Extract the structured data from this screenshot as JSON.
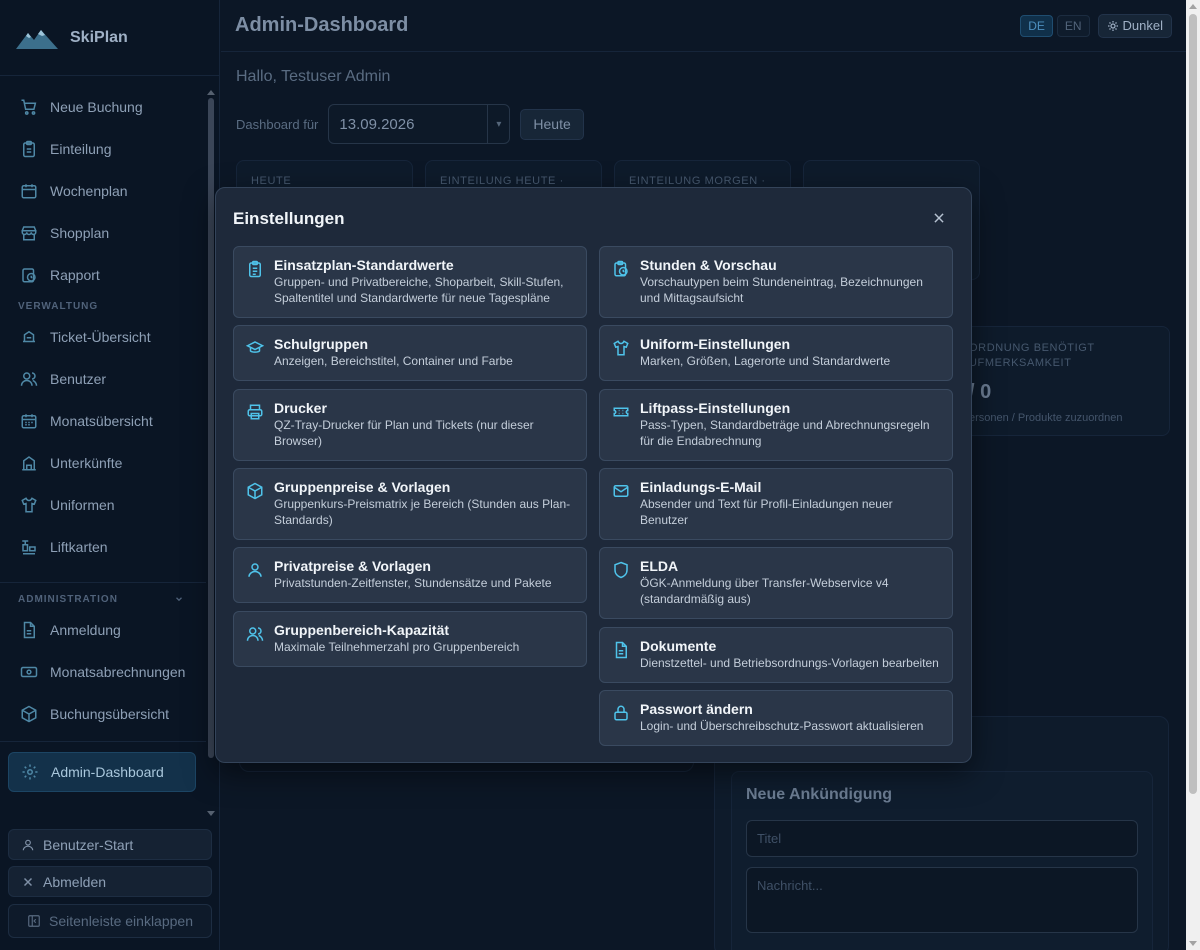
{
  "app": {
    "name": "SkiPlan"
  },
  "sidebar": {
    "items": [
      {
        "label": "Neue Buchung",
        "icon": "cart-icon"
      },
      {
        "label": "Einteilung",
        "icon": "clipboard-icon"
      },
      {
        "label": "Wochenplan",
        "icon": "calendar-icon"
      },
      {
        "label": "Shopplan",
        "icon": "store-icon"
      },
      {
        "label": "Rapport",
        "icon": "clock-report-icon"
      }
    ],
    "section_admin_title": "VERWALTUNG",
    "admin_items": [
      {
        "label": "Ticket-Übersicht",
        "icon": "ticket-icon"
      },
      {
        "label": "Benutzer",
        "icon": "users-icon"
      },
      {
        "label": "Monatsübersicht",
        "icon": "calendar-icon"
      },
      {
        "label": "Unterkünfte",
        "icon": "building-icon"
      },
      {
        "label": "Uniformen",
        "icon": "shirt-icon"
      },
      {
        "label": "Liftkarten",
        "icon": "lift-icon"
      }
    ],
    "section_administration_title": "ADMINISTRATION",
    "administration_items": [
      {
        "label": "Anmeldung",
        "icon": "document-icon"
      },
      {
        "label": "Monatsabrechnungen",
        "icon": "money-icon"
      },
      {
        "label": "Buchungsübersicht",
        "icon": "box-icon"
      }
    ],
    "active_item": {
      "label": "Admin-Dashboard",
      "icon": "gear-icon"
    },
    "user_start_label": "Benutzer-Start",
    "logout_label": "Abmelden",
    "collapse_label": "Seitenleiste einklappen"
  },
  "header": {
    "title": "Admin-Dashboard",
    "lang_de": "DE",
    "lang_en": "EN",
    "theme_label": "Dunkel"
  },
  "dashboard": {
    "greeting": "Hallo, Testuser Admin",
    "date_label": "Dashboard für",
    "date_value": "13.09.2026",
    "today_label": "Heute",
    "stats": [
      "HEUTE",
      "EINTEILUNG HEUTE ·",
      "EINTEILUNG MORGEN ·",
      ""
    ],
    "attention_card": {
      "title": "ORDNUNG BENÖTIGT UFMERKSAMKEIT",
      "value": "/ 0",
      "subtitle": "ersonen / Produkte zuzuordnen"
    },
    "announcement": {
      "title": "Neue Ankündigung",
      "title_placeholder": "Titel",
      "message_placeholder": "Nachricht..."
    }
  },
  "modal": {
    "title": "Einstellungen",
    "left": [
      {
        "title": "Einsatzplan-Standardwerte",
        "desc": "Gruppen- und Privatbereiche, Shoparbeit, Skill-Stufen, Spaltentitel und Standardwerte für neue Tagespläne",
        "icon": "clipboard-icon"
      },
      {
        "title": "Schulgruppen",
        "desc": "Anzeigen, Bereichstitel, Container und Farbe",
        "icon": "graduation-cap-icon"
      },
      {
        "title": "Drucker",
        "desc": "QZ-Tray-Drucker für Plan und Tickets (nur dieser Browser)",
        "icon": "printer-icon"
      },
      {
        "title": "Gruppenpreise & Vorlagen",
        "desc": "Gruppenkurs-Preismatrix je Bereich (Stunden aus Plan-Standards)",
        "icon": "cube-icon"
      },
      {
        "title": "Privatpreise & Vorlagen",
        "desc": "Privatstunden-Zeitfenster, Stundensätze und Pakete",
        "icon": "user-icon"
      },
      {
        "title": "Gruppenbereich-Kapazität",
        "desc": "Maximale Teilnehmerzahl pro Gruppenbereich",
        "icon": "users-icon"
      }
    ],
    "right": [
      {
        "title": "Stunden & Vorschau",
        "desc": "Vorschautypen beim Stundeneintrag, Bezeichnungen und Mittagsaufsicht",
        "icon": "clock-clipboard-icon"
      },
      {
        "title": "Uniform-Einstellungen",
        "desc": "Marken, Größen, Lagerorte und Standardwerte",
        "icon": "shirt-icon"
      },
      {
        "title": "Liftpass-Einstellungen",
        "desc": "Pass-Typen, Standardbeträge und Abrechnungsregeln für die Endabrechnung",
        "icon": "ticket-icon"
      },
      {
        "title": "Einladungs-E-Mail",
        "desc": "Absender und Text für Profil-Einladungen neuer Benutzer",
        "icon": "mail-icon"
      },
      {
        "title": "ELDA",
        "desc": "ÖGK-Anmeldung über Transfer-Webservice v4 (standardmäßig aus)",
        "icon": "shield-icon"
      },
      {
        "title": "Dokumente",
        "desc": "Dienstzettel- und Betriebsordnungs-Vorlagen bearbeiten",
        "icon": "file-icon"
      },
      {
        "title": "Passwort ändern",
        "desc": "Login- und Überschreibschutz-Passwort aktualisieren",
        "icon": "lock-icon"
      }
    ]
  }
}
